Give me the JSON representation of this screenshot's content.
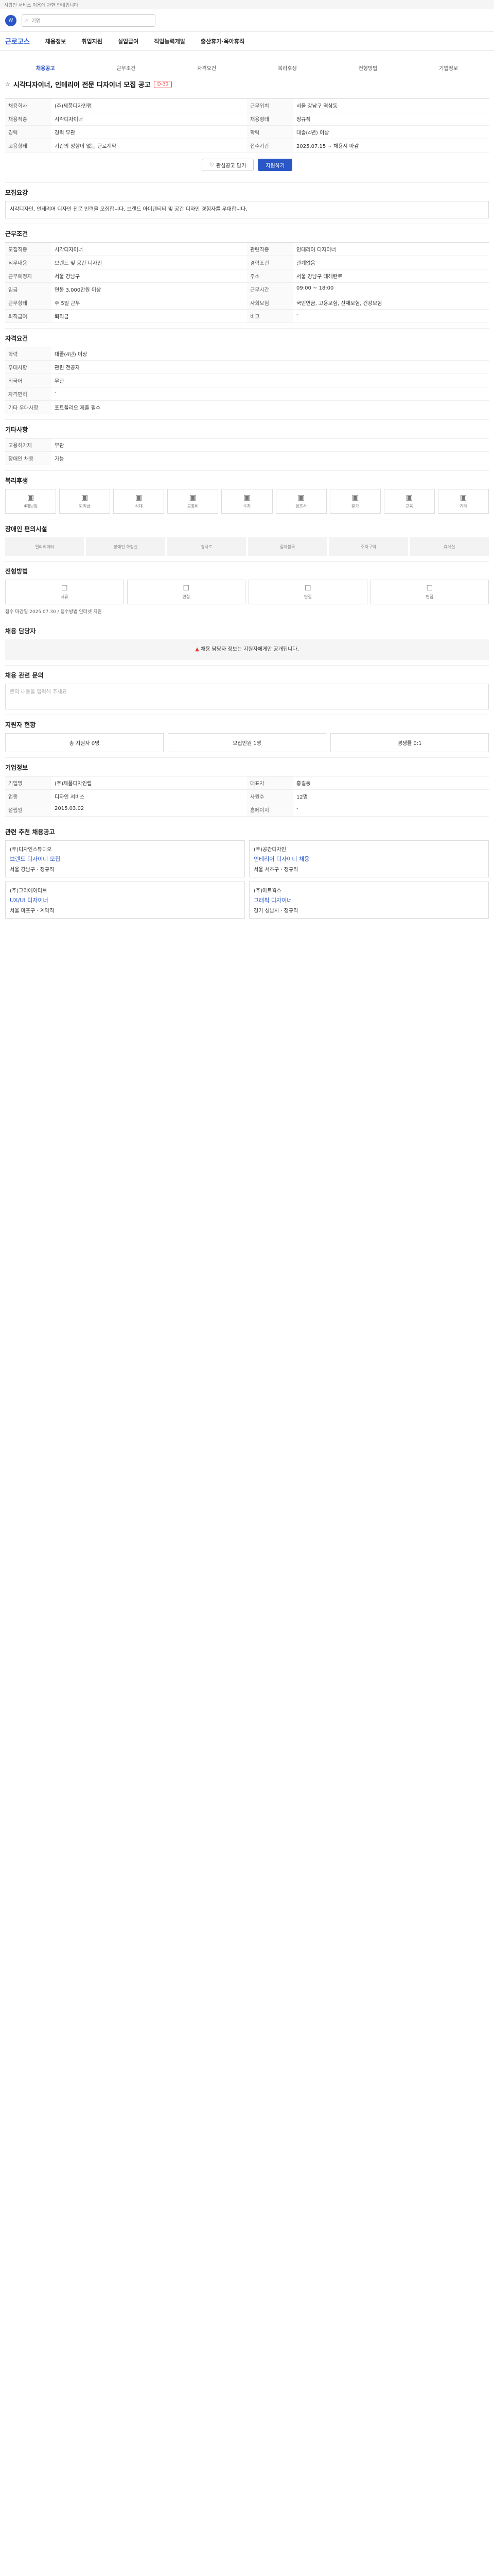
{
  "notice": "사람인 서비스 이용에 관한 안내입니다",
  "search": {
    "placeholder": "기업",
    "value": "기업"
  },
  "gnb": {
    "brand": "근로고스",
    "items": [
      "채용정보",
      "취업지원",
      "실업급여",
      "직업능력개발",
      "출산휴가·육아휴직"
    ]
  },
  "tabs": [
    "채용공고",
    "근무조건",
    "자격요건",
    "복리후생",
    "전형방법",
    "기업정보"
  ],
  "title": "시각디자이너, 인테리어 전문 디자이너 모집 공고",
  "chip": "D-30",
  "summary": [
    [
      "채용회사",
      "(주)제품디자인랩",
      "근무위치",
      "서울 강남구 역삼동"
    ],
    [
      "채용직종",
      "시각디자이너",
      "채용형태",
      "정규직"
    ],
    [
      "경력",
      "경력 무관",
      "학력",
      "대졸(4년) 이상"
    ],
    [
      "고용형태",
      "기간의 정함이 없는 근로계약",
      "접수기간",
      "2025.07.15 ~ 채용시 마감"
    ]
  ],
  "buttons": {
    "interest": "관심공고 담기",
    "apply": "지원하기"
  },
  "desc_title": "모집요강",
  "desc": "시각디자인, 인테리어 디자인 전문 인력을 모집합니다. 브랜드 아이덴티티 및 공간 디자인 경험자를 우대합니다.",
  "work_title": "근무조건",
  "work": [
    [
      "모집직종",
      "시각디자이너",
      "관련직종",
      "인테리어 디자이너"
    ],
    [
      "직무내용",
      "브랜드 및 공간 디자인",
      "경력조건",
      "관계없음"
    ],
    [
      "근무예정지",
      "서울 강남구",
      "주소",
      "서울 강남구 테헤란로"
    ],
    [
      "임금",
      "연봉 3,000만원 이상",
      "근무시간",
      "09:00 ~ 18:00"
    ],
    [
      "근무형태",
      "주 5일 근무",
      "사회보험",
      "국민연금, 고용보험, 산재보험, 건강보험"
    ],
    [
      "퇴직급여",
      "퇴직금",
      "비고",
      "-"
    ]
  ],
  "req_title": "자격요건",
  "req": [
    [
      "학력",
      "대졸(4년) 이상"
    ],
    [
      "우대사항",
      "관련 전공자"
    ],
    [
      "외국어",
      "무관"
    ],
    [
      "자격면허",
      "-"
    ],
    [
      "기타 우대사항",
      "포트폴리오 제출 필수"
    ]
  ],
  "etc_title": "기타사항",
  "etc": [
    [
      "고용허가제",
      "무관"
    ],
    [
      "장애인 채용",
      "가능"
    ]
  ],
  "welfare_title": "복리후생",
  "icons": [
    "4대보험",
    "퇴직금",
    "식대",
    "교통비",
    "주차",
    "경조사",
    "휴가",
    "교육",
    "기타"
  ],
  "office_title": "장애인 편의시설",
  "office": [
    "엘리베이터",
    "장애인 화장실",
    "경사로",
    "점자블록",
    "주차구역",
    "휴게실"
  ],
  "apply_title": "전형방법",
  "methods": [
    "서류",
    "면접",
    "면접",
    "면접"
  ],
  "apply_info": "접수 마감일 2025.07.30 / 접수방법 인터넷 지원",
  "contact_title": "채용 담당자",
  "contact_text": "채용 담당자 정보는 지원자에게만 공개됩니다.",
  "faq_title": "채용 관련 문의",
  "faq_placeholder": "문의 내용을 입력해 주세요",
  "stat_title": "지원자 현황",
  "stats": [
    "총 지원자 0명",
    "모집인원 1명",
    "경쟁률 0:1"
  ],
  "company_title": "기업정보",
  "company": [
    [
      "기업명",
      "(주)제품디자인랩",
      "대표자",
      "홍길동"
    ],
    [
      "업종",
      "디자인 서비스",
      "사원수",
      "12명"
    ],
    [
      "설립일",
      "2015.03.02",
      "홈페이지",
      "-"
    ]
  ],
  "related_title": "관련 추천 채용공고",
  "cards": [
    {
      "co": "(주)디자인스튜디오",
      "t": "브랜드 디자이너 모집",
      "d": "서울 강남구 · 정규직"
    },
    {
      "co": "(주)공간디자인",
      "t": "인테리어 디자이너 채용",
      "d": "서울 서초구 · 정규직"
    },
    {
      "co": "(주)크리에이티브",
      "t": "UX/UI 디자이너",
      "d": "서울 마포구 · 계약직"
    },
    {
      "co": "(주)아트웍스",
      "t": "그래픽 디자이너",
      "d": "경기 성남시 · 정규직"
    }
  ]
}
